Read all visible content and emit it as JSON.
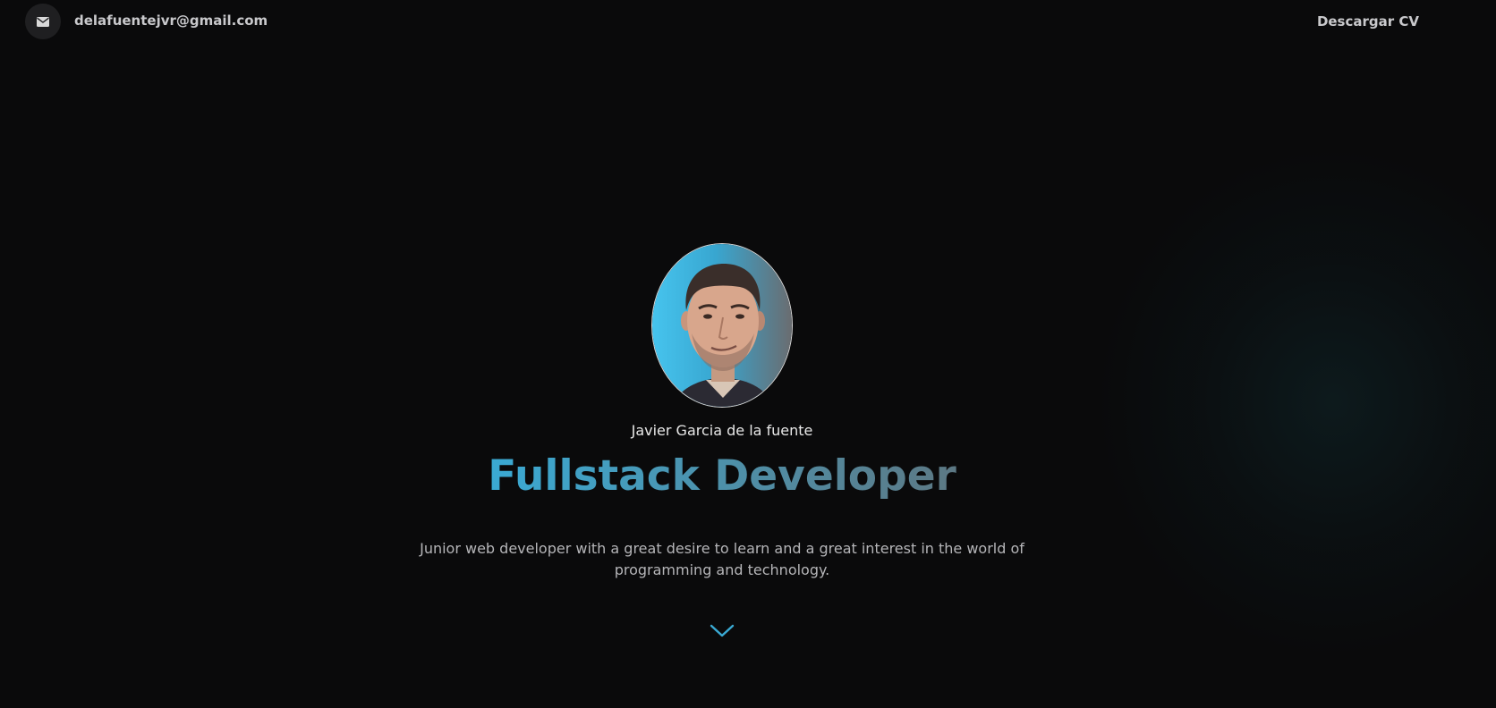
{
  "header": {
    "email": "delafuentejvr@gmail.com",
    "cv_label": "Descargar CV",
    "email_icon": "envelope-icon"
  },
  "hero": {
    "name": "Javier Garcia de la fuente",
    "title": "Fullstack Developer",
    "description": "Junior web developer with a great desire to learn and a great interest in the world of programming and technology.",
    "scroll_icon": "chevron-down-icon"
  },
  "colors": {
    "background": "#0a0a0b",
    "accent": "#3aaad4",
    "title_gradient_end": "#5c7884",
    "text_muted": "#b5b5b8"
  }
}
